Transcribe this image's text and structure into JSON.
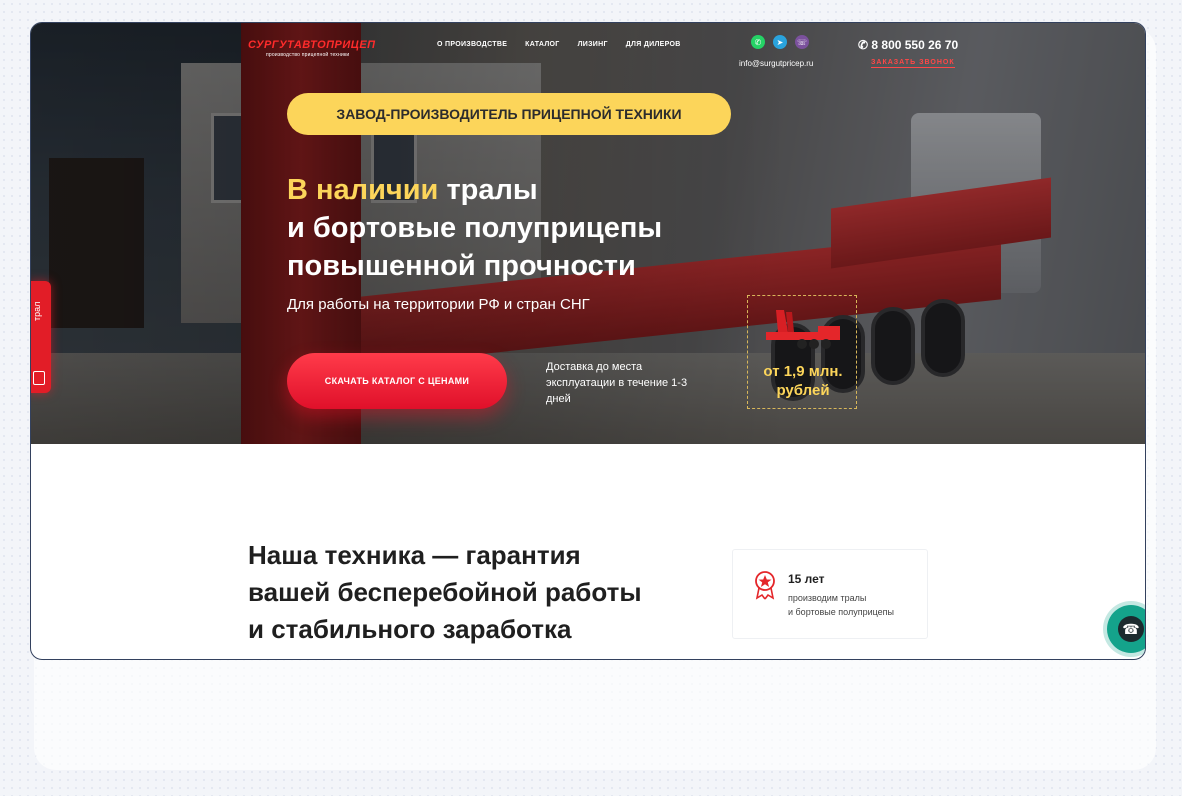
{
  "brand": {
    "name": "СУРГУТАВТОПРИЦЕП",
    "tagline": "производство прицепной техники"
  },
  "nav": {
    "items": [
      "О ПРОИЗВОДСТВЕ",
      "КАТАЛОГ",
      "ЛИЗИНГ",
      "ДЛЯ ДИЛЕРОВ"
    ]
  },
  "contacts": {
    "email": "info@surgutpricep.ru",
    "phone": "8 800 550 26 70",
    "callback": "ЗАКАЗАТЬ ЗВОНОК",
    "socials": [
      "whatsapp-icon",
      "telegram-icon",
      "viber-icon"
    ]
  },
  "hero": {
    "badge": "ЗАВОД-ПРОИЗВОДИТЕЛЬ ПРИЦЕПНОЙ ТЕХНИКИ",
    "headline_accent": "В наличии",
    "headline_rest1": " тралы",
    "headline_line2": "и бортовые полуприцепы",
    "headline_line3": "повышенной прочности",
    "subline": "Для работы на территории РФ и стран СНГ",
    "cta": "СКАЧАТЬ КАТАЛОГ С ЦЕНАМИ",
    "delivery": "Доставка до места эксплуатации в течение 1-3 дней",
    "price": "от 1,9 млн. рублей"
  },
  "side_tab": {
    "label": "трал"
  },
  "section": {
    "title_plain": "Наша техника",
    "title_bold1": " — гарантия",
    "title_bold2": "вашей бесперебойной работы",
    "title_bold3": "и стабильного заработка"
  },
  "stat": {
    "value": "15 лет",
    "desc_line1": "производим тралы",
    "desc_line2": "и бортовые полуприцепы"
  },
  "colors": {
    "accent_yellow": "#fcd55a",
    "brand_red": "#e21d27",
    "call_green": "#14a38b"
  }
}
